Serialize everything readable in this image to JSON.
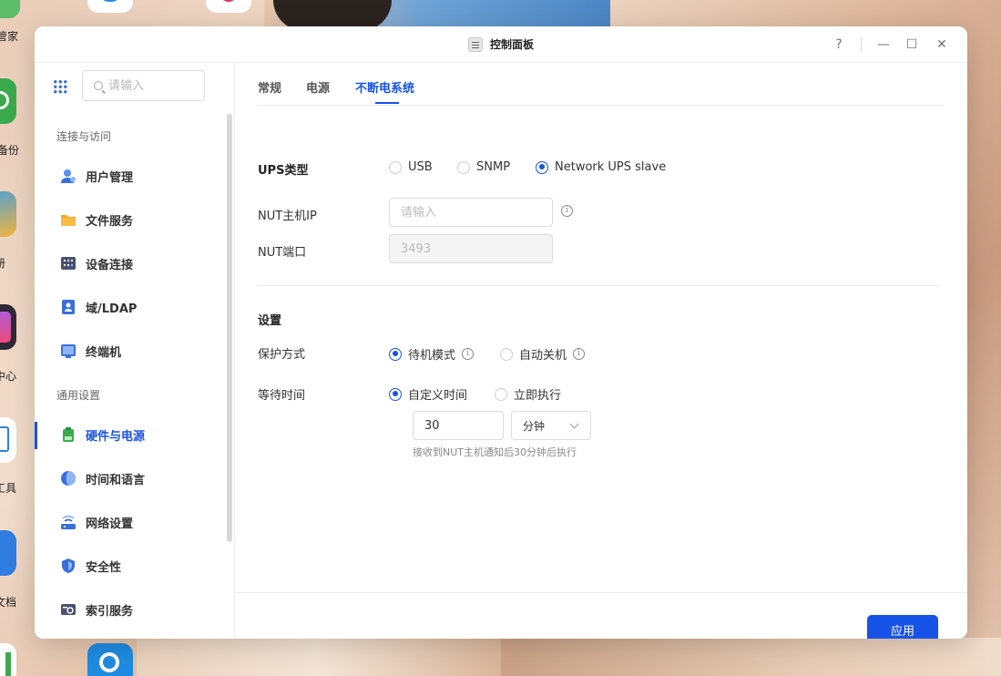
{
  "desktop": {
    "labels": [
      "管家",
      "备份",
      "册",
      "中心",
      "工具",
      "文档"
    ]
  },
  "window": {
    "title": "控制面板",
    "controls": {
      "help": "?",
      "minimize": "—",
      "maximize": "☐",
      "close": "✕"
    }
  },
  "sidebar": {
    "search_placeholder": "请输入",
    "groups": [
      {
        "title": "连接与访问",
        "items": [
          "用户管理",
          "文件服务",
          "设备连接",
          "域/LDAP",
          "终端机"
        ]
      },
      {
        "title": "通用设置",
        "items": [
          "硬件与电源",
          "时间和语言",
          "网络设置",
          "安全性",
          "索引服务"
        ]
      }
    ],
    "active_item": "硬件与电源"
  },
  "tabs": [
    "常规",
    "电源",
    "不断电系统"
  ],
  "active_tab": "不断电系统",
  "ups": {
    "type_label": "UPS类型",
    "types": [
      "USB",
      "SNMP",
      "Network UPS slave"
    ],
    "selected_type": "Network UPS slave",
    "nut_ip_label": "NUT主机IP",
    "nut_ip_placeholder": "请输入",
    "nut_port_label": "NUT端口",
    "nut_port_value": "3493"
  },
  "settings": {
    "title": "设置",
    "protect_label": "保护方式",
    "protect_options": [
      "待机模式",
      "自动关机"
    ],
    "protect_selected": "待机模式",
    "wait_label": "等待时间",
    "wait_options": [
      "自定义时间",
      "立即执行"
    ],
    "wait_selected": "自定义时间",
    "wait_value": "30",
    "wait_unit": "分钟",
    "hint": "接收到NUT主机通知后30分钟后执行"
  },
  "apply_label": "应用",
  "colors": {
    "accent": "#1753e6"
  }
}
